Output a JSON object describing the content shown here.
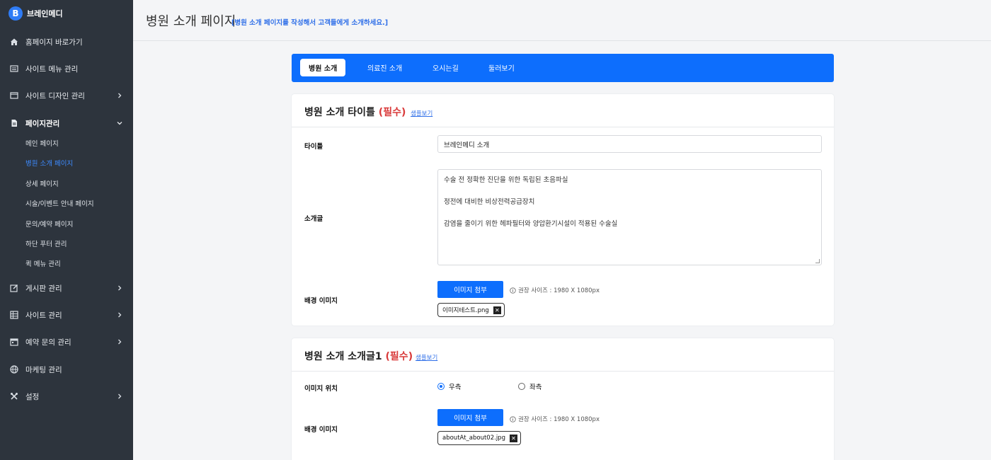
{
  "brand": {
    "logo_letter": "B",
    "name": "브레인메디"
  },
  "sidebar": {
    "items": [
      {
        "label": "홈페이지 바로가기",
        "icon": "home-icon"
      },
      {
        "label": "사이트 메뉴 관리",
        "icon": "menu-list-icon"
      },
      {
        "label": "사이트 디자인 관리",
        "icon": "window-icon"
      },
      {
        "label": "페이지관리",
        "icon": "document-icon"
      },
      {
        "label": "게시판 관리",
        "icon": "edit-icon"
      },
      {
        "label": "사이트 관리",
        "icon": "grid-icon"
      },
      {
        "label": "예약 문의 관리",
        "icon": "calendar-icon"
      },
      {
        "label": "마케팅 관리",
        "icon": "globe-icon"
      },
      {
        "label": "설정",
        "icon": "tools-icon"
      }
    ],
    "sub_items": [
      {
        "label": "메인 페이지"
      },
      {
        "label": "병원 소개 페이지"
      },
      {
        "label": "상세 페이지"
      },
      {
        "label": "시술/이벤트 안내 페이지"
      },
      {
        "label": "문의/예약 페이지"
      },
      {
        "label": "하단 푸터 관리"
      },
      {
        "label": "퀵 메뉴 관리"
      }
    ],
    "active_sub": "병원 소개 페이지"
  },
  "header": {
    "title": "병원 소개 페이지",
    "description": "[병원 소개 페이지를 작성해서 고객들에게 소개하세요.]"
  },
  "tabs": [
    {
      "label": "병원 소개",
      "active": true
    },
    {
      "label": "의료진 소개",
      "active": false
    },
    {
      "label": "오시는길",
      "active": false
    },
    {
      "label": "둘러보기",
      "active": false
    }
  ],
  "section1": {
    "title": "병원 소개 타이틀",
    "required": "(필수)",
    "sample_link": "샘플보기",
    "title_label": "타이틀",
    "title_value": "브레인메디 소개",
    "intro_label": "소개글",
    "intro_lines": [
      "수술 전 정확한 진단을 위한 독립된 초음파실",
      "정전에 대비한 비상전력공급장치",
      "감염을 줄이기 위한 헤파필터와 양압환기시설이 적용된 수술실"
    ],
    "bg_label": "배경 이미지",
    "attach_button": "이미지 첨부",
    "hint": "권장 사이즈 : 1980 X 1080px",
    "file_name": "이미지테스트.png"
  },
  "section2": {
    "title": "병원 소개 소개글1",
    "required": "(필수)",
    "sample_link": "샘플보기",
    "position_label": "이미지 위치",
    "position_options": [
      "우측",
      "좌측"
    ],
    "position_selected": "우측",
    "bg_label": "배경 이미지",
    "attach_button": "이미지 첨부",
    "hint": "권장 사이즈 : 1980 X 1080px",
    "file_name": "aboutAt_about02.jpg"
  },
  "colors": {
    "sidebar_bg": "#2d343d",
    "accent": "#0d6efd",
    "active_link": "#3d8bff",
    "required": "#d93a3a"
  }
}
